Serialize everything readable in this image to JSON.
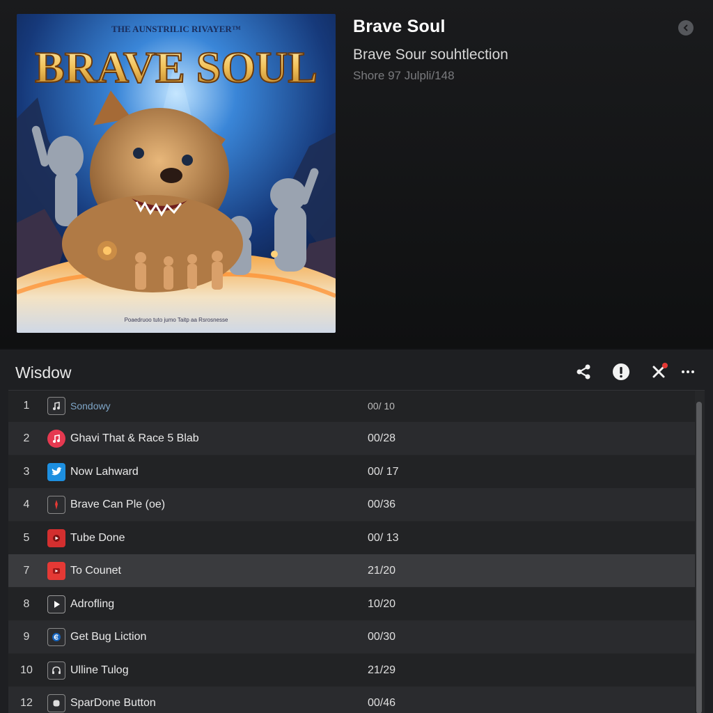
{
  "album": {
    "cover_alt": "Brave Soul cover art",
    "cover_tagline": "THE AUNSTRILIC RIVAYER™",
    "cover_title": "BRAVE SOUL",
    "cover_credits": "Poaedruoo tuto jumo Taitp aa Rsrosnesse",
    "title": "Brave Soul",
    "subtitle": "Brave Sour souhtlection",
    "info": "Shore 97 Julpli/148"
  },
  "list": {
    "title": "Wisdow",
    "icons": {
      "share": "share-icon",
      "info": "info-icon",
      "close": "close-icon",
      "more": "more-icon"
    },
    "more_label": "···",
    "tracks": [
      {
        "num": "1",
        "name": "Sondowy",
        "duration": "00/ 10",
        "icon": "music-note-icon",
        "icon_color": "#2b2c2f"
      },
      {
        "num": "2",
        "name": "Ghavi That & Race 5 Blab",
        "duration": "00/28",
        "icon": "music-app-icon",
        "icon_color": "#e53950"
      },
      {
        "num": "3",
        "name": "Now Lahward",
        "duration": "00/ 17",
        "icon": "bird-icon",
        "icon_color": "#1d8fe0"
      },
      {
        "num": "4",
        "name": "Brave Can Ple (oe)",
        "duration": "00/36",
        "icon": "flame-icon",
        "icon_color": "#2b2c2f"
      },
      {
        "num": "5",
        "name": "Tube Done",
        "duration": "00/ 13",
        "icon": "tube-icon",
        "icon_color": "#d32f2f"
      },
      {
        "num": "7",
        "name": "To Counet",
        "duration": "21/20",
        "icon": "tube-icon",
        "icon_color": "#e53935"
      },
      {
        "num": "8",
        "name": "Adrofling",
        "duration": "10/20",
        "icon": "play-icon",
        "icon_color": "#2b2c2f"
      },
      {
        "num": "9",
        "name": "Get Bug Liction",
        "duration": "00/30",
        "icon": "circle-e-icon",
        "icon_color": "#2b2c2f"
      },
      {
        "num": "10",
        "name": "Ulline Tulog",
        "duration": "21/29",
        "icon": "headphones-icon",
        "icon_color": "#2b2c2f"
      },
      {
        "num": "12",
        "name": "SparDone Button",
        "duration": "00/46",
        "icon": "square-icon",
        "icon_color": "#2b2c2f"
      }
    ]
  },
  "colors": {
    "accent_red": "#e53935",
    "background": "#111214",
    "panel": "#1e1f22"
  }
}
